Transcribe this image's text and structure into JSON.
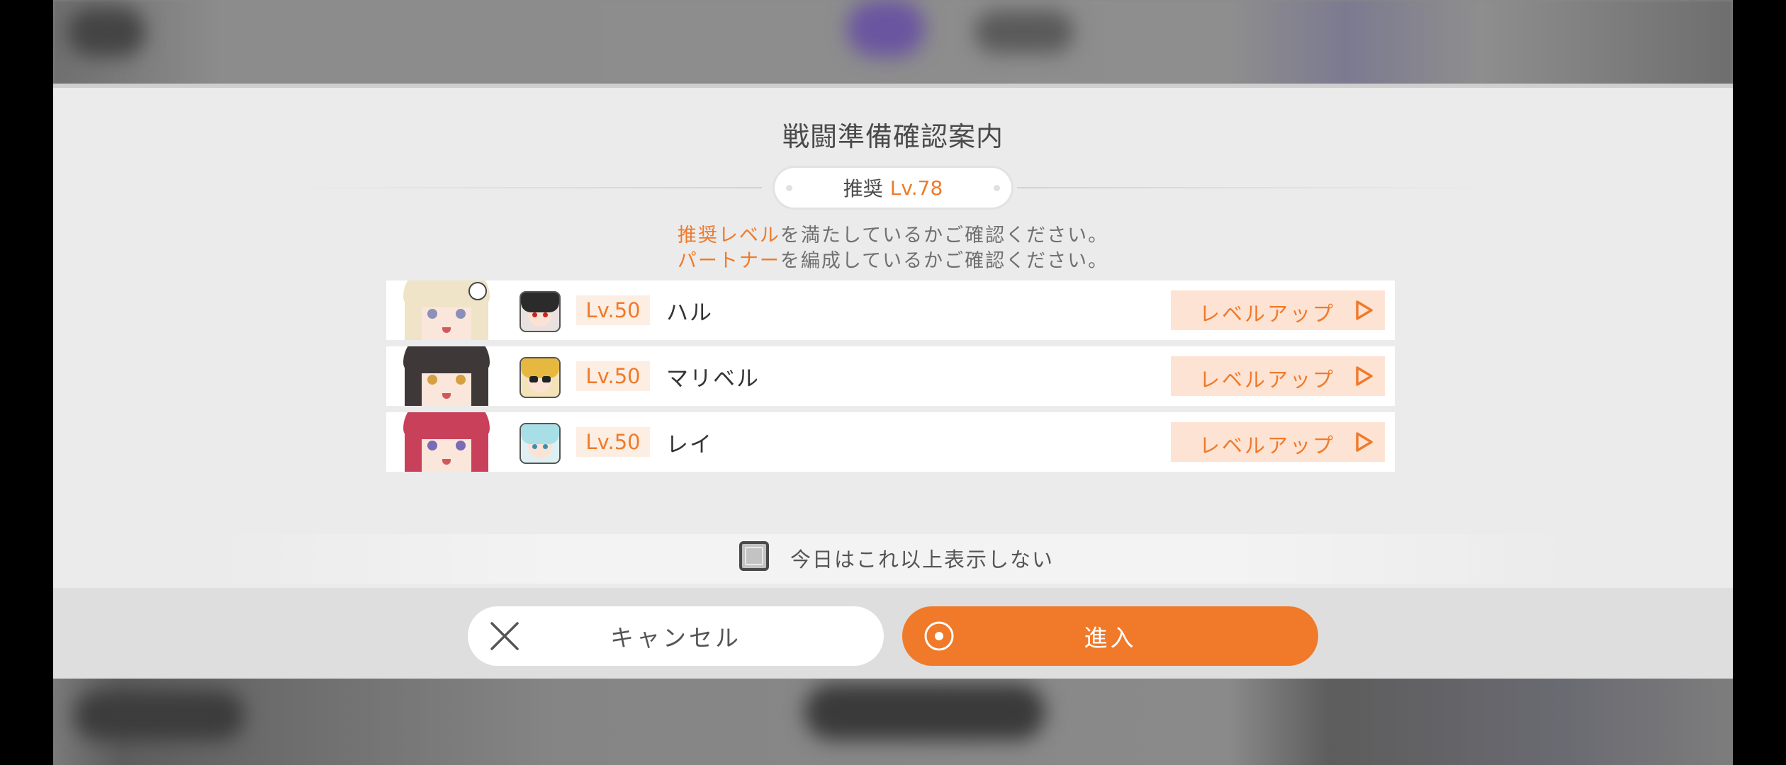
{
  "dialog": {
    "title": "戦闘準備確認案内",
    "recommended": {
      "label": "推奨",
      "value": "Lv.78"
    },
    "notices": [
      {
        "highlight": "推奨レベル",
        "text": "を満たしているかご確認ください。"
      },
      {
        "highlight": "パートナー",
        "text": "を編成しているかご確認ください。"
      }
    ],
    "characters": [
      {
        "level": "Lv.50",
        "name": "ハル",
        "action": "レベルアップ"
      },
      {
        "level": "Lv.50",
        "name": "マリベル",
        "action": "レベルアップ"
      },
      {
        "level": "Lv.50",
        "name": "レイ",
        "action": "レベルアップ"
      }
    ],
    "skip_today": {
      "label": "今日はこれ以上表示しない",
      "checked": false
    },
    "buttons": {
      "cancel": "キャンセル",
      "enter": "進入"
    }
  },
  "colors": {
    "accent": "#f07a2a",
    "accent_light": "#fde3d4",
    "panel": "#ebebeb",
    "footer": "#dedede"
  },
  "icons": [
    "close-x-icon",
    "target-circle-icon",
    "play-triangle-icon"
  ]
}
